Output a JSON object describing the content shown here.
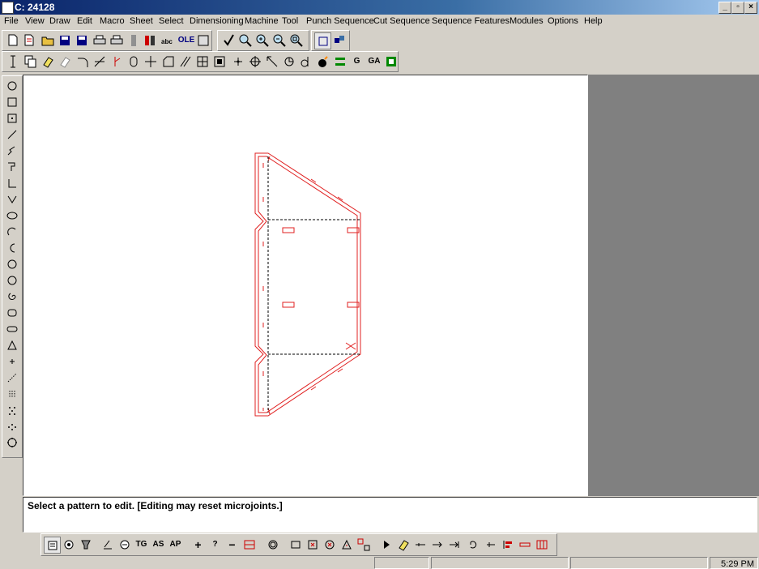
{
  "window": {
    "title": "C: 24128"
  },
  "menu": [
    "File",
    "View",
    "Draw",
    "Edit",
    "Macro",
    "Sheet",
    "Select",
    "Dimensioning",
    "Machine",
    "Tool",
    "Punch Sequence",
    "Cut Sequence",
    "Sequence Features",
    "Modules",
    "Options",
    "Help"
  ],
  "toolbar1": {
    "ole_label": "OLE"
  },
  "toolbar2": {
    "g_label": "G",
    "ga_label": "GA"
  },
  "bottom_toolbar": {
    "tg_label": "TG",
    "as_label": "AS",
    "ap_label": "AP",
    "plus_label": "+",
    "question_label": "?",
    "minus_label": "−"
  },
  "status": {
    "message": "Select a pattern to edit.   [Editing may reset microjoints.]",
    "time": "5:29 PM"
  },
  "colors": {
    "drawing": "#e02020",
    "title_start": "#0a246a",
    "title_end": "#a6caf0"
  }
}
